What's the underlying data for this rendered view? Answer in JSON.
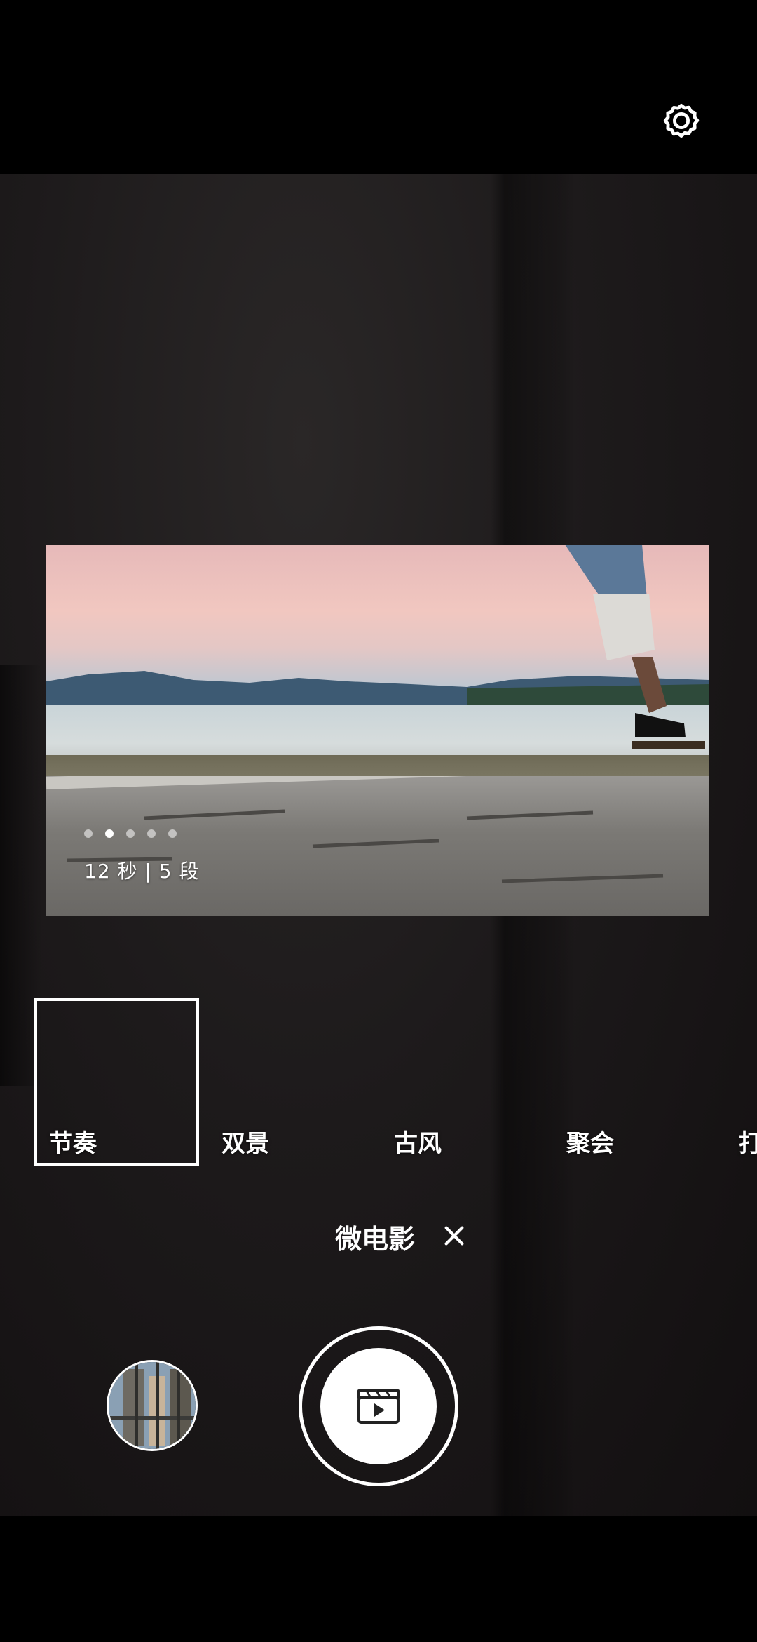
{
  "preview": {
    "info_text": "12 秒 | 5 段",
    "page_dots": 5,
    "active_dot_index": 1
  },
  "templates": [
    {
      "label": "节奏",
      "selected": true
    },
    {
      "label": "双景",
      "selected": false
    },
    {
      "label": "古风",
      "selected": false
    },
    {
      "label": "聚会",
      "selected": false
    },
    {
      "label": "打",
      "selected": false
    }
  ],
  "mode": {
    "title": "微电影",
    "close_icon": "close-icon"
  },
  "icons": {
    "settings": "gear-icon",
    "shutter": "movie-clapper-icon"
  },
  "colors": {
    "accent": "#ffffff",
    "background": "#000000"
  }
}
